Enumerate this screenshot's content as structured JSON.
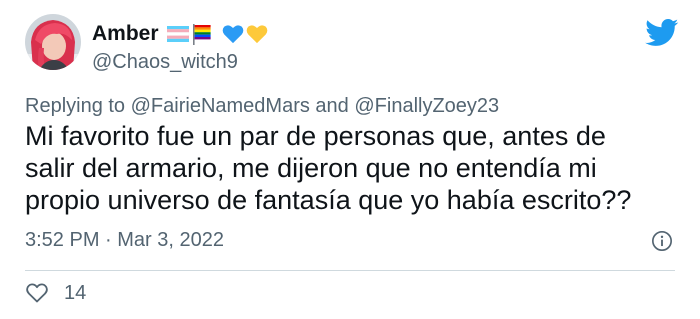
{
  "author": {
    "display_name": "Amber",
    "handle": "@Chaos_witch9",
    "emojis": [
      "trans-flag",
      "rainbow",
      "blue-heart",
      "yellow-heart"
    ]
  },
  "reply": {
    "prefix": "Replying to",
    "mention1": "@FairieNamedMars",
    "conjunction": "and",
    "mention2": "@FinallyZoey23"
  },
  "tweet": {
    "lines": [
      "Mi favorito fue un par de personas que, antes de",
      "salir del armario, me dijeron que no entendía mi",
      "propio universo de fantasía que yo había escrito??"
    ],
    "timestamp": "3:52 PM · Mar 3, 2022"
  },
  "actions": {
    "like_count": "14"
  },
  "colors": {
    "twitter_blue": "#1d9bf0",
    "secondary_text": "#536471",
    "avatar_hair": "#e8415b"
  },
  "icons": {
    "logo": "twitter-bird-icon",
    "info": "info-icon",
    "like": "heart-icon"
  }
}
